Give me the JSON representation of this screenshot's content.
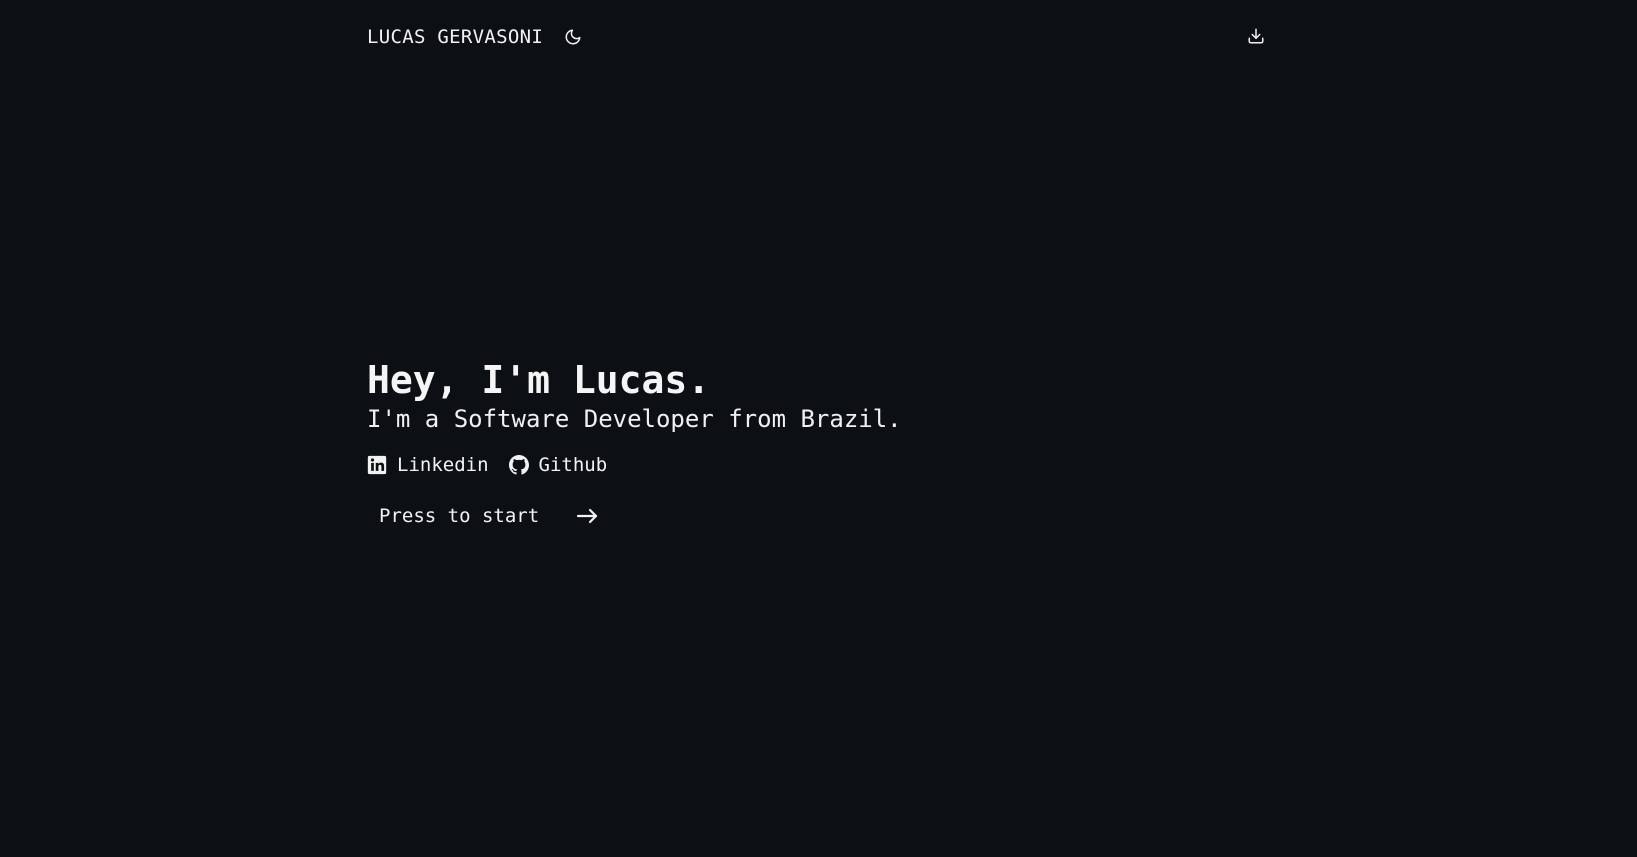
{
  "header": {
    "brand": "LUCAS GERVASONI",
    "theme_icon": "moon-icon",
    "download_icon": "download-icon"
  },
  "hero": {
    "title": "Hey, I'm Lucas.",
    "subtitle": "I'm a Software Developer from Brazil."
  },
  "socials": [
    {
      "label": "Linkedin",
      "icon": "linkedin-icon"
    },
    {
      "label": "Github",
      "icon": "github-icon"
    }
  ],
  "cta": {
    "label": "Press to start",
    "icon": "arrow-right-icon"
  },
  "colors": {
    "background": "#0c1014",
    "text": "#f2f2f2"
  }
}
